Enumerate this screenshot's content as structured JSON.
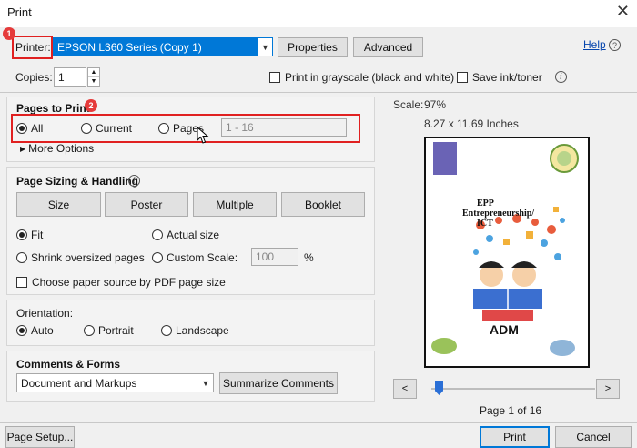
{
  "window": {
    "title": "Print",
    "close_glyph": "✕"
  },
  "printer": {
    "label": "Printer:",
    "selected": "EPSON L360 Series (Copy 1)",
    "properties_label": "Properties",
    "advanced_label": "Advanced",
    "help_label": "Help",
    "help_icon_glyph": "?",
    "copies_label": "Copies:",
    "copies_value": "1",
    "grayscale_label": "Print in grayscale (black and white)",
    "save_ink_label": "Save ink/toner",
    "badge_number": "1"
  },
  "pages_to_print": {
    "heading": "Pages to Print",
    "badge_number": "2",
    "all_label": "All",
    "current_label": "Current",
    "pages_label": "Pages",
    "pages_placeholder": "1 - 16",
    "more_options_label": "More Options"
  },
  "page_sizing": {
    "heading": "Page Sizing & Handling",
    "size_label": "Size",
    "poster_label": "Poster",
    "multiple_label": "Multiple",
    "booklet_label": "Booklet",
    "fit_label": "Fit",
    "actual_size_label": "Actual size",
    "shrink_label": "Shrink oversized pages",
    "custom_scale_label": "Custom Scale:",
    "custom_scale_value": "100",
    "percent_label": "%",
    "paper_source_label": "Choose paper source by PDF page size"
  },
  "orientation": {
    "heading": "Orientation:",
    "auto_label": "Auto",
    "portrait_label": "Portrait",
    "landscape_label": "Landscape"
  },
  "comments_forms": {
    "heading": "Comments & Forms",
    "selected": "Document and Markups",
    "summarize_label": "Summarize Comments"
  },
  "preview": {
    "scale_label": "Scale:",
    "scale_value": "97%",
    "dimensions": "8.27 x 11.69 Inches",
    "doc_title_line1": "EPP",
    "doc_title_line2": "Entrepreneurship/",
    "doc_title_line3": "ICT",
    "doc_footer_text": "ADM",
    "prev_label": "<",
    "next_label": ">",
    "page_indicator": "Page 1 of 16",
    "slider_fraction": 0.0
  },
  "footer": {
    "page_setup_label": "Page Setup...",
    "print_label": "Print",
    "cancel_label": "Cancel"
  }
}
